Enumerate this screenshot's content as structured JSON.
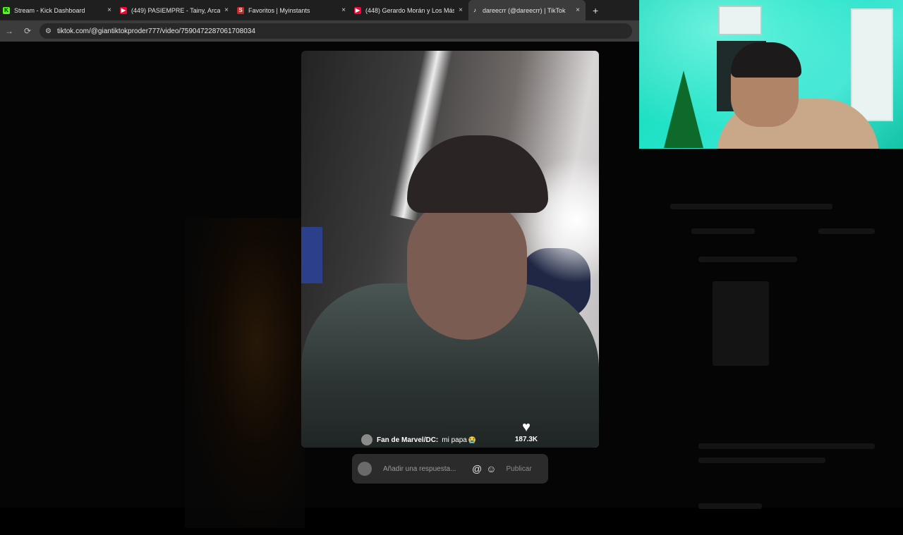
{
  "browser": {
    "tabs": [
      {
        "title": "Stream - Kick Dashboard",
        "favicon": "kick-icon",
        "active": false
      },
      {
        "title": "(449) PASIEMPRE - Tainy, Arcangel",
        "favicon": "youtube-icon",
        "active": false
      },
      {
        "title": "Favoritos | Myinstants",
        "favicon": "myinstants-icon",
        "active": false
      },
      {
        "title": "(448) Gerardo Morán y Los Más",
        "favicon": "youtube-icon",
        "active": false
      },
      {
        "title": "dareecrr (@dareecrr) | TikTok",
        "favicon": "tiktok-icon",
        "active": true
      }
    ],
    "close_glyph": "×",
    "new_tab_glyph": "+",
    "back_glyph": "→",
    "reload_glyph": "⟳",
    "address": "tiktok.com/@giantiktokproder777/video/7590472287061708034"
  },
  "video": {
    "caption_user": "Fan de Marvel/DC:",
    "caption_text": "mi papa",
    "caption_emoji": "😭",
    "likes": "187.3K"
  },
  "reply": {
    "placeholder": "Añadir una respuesta...",
    "mention_glyph": "@",
    "emoji_glyph": "☺",
    "publish_label": "Publicar"
  },
  "colors": {
    "tab_bar": "#1f1f1f",
    "address_bar": "#3c3c3c",
    "page_bg": "#050505",
    "webcam_bg": "#22e3c7"
  }
}
